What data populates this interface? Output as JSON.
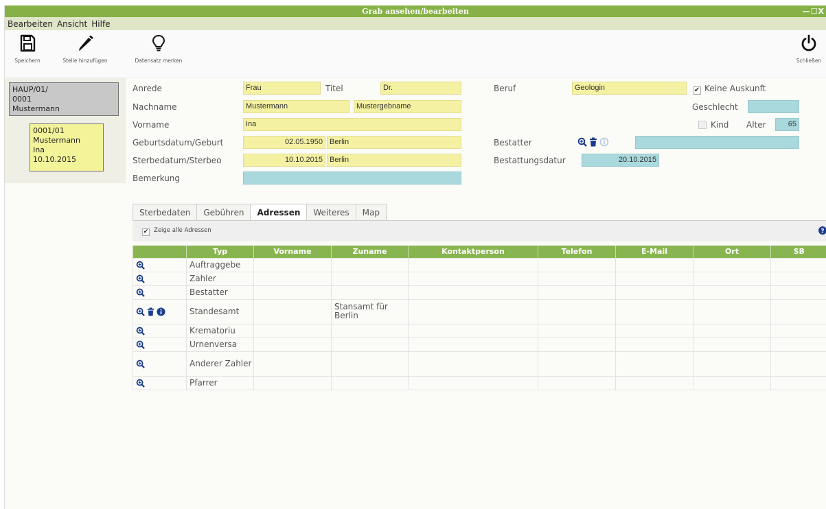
{
  "window": {
    "title": "Grab ansehen/bearbeiten",
    "controls": "—☐X"
  },
  "menu": [
    "Bearbeiten",
    "Ansicht",
    "Hilfe"
  ],
  "toolbar": {
    "save": "Speichern",
    "add_place": "Stelle hinzufügen",
    "mark": "Datensatz merken",
    "close": "Schließen"
  },
  "tree": {
    "parent": [
      "HAUP/01/",
      "0001",
      "Mustermann"
    ],
    "child": [
      "0001/01",
      "Mustermann",
      "Ina",
      "10.10.2015"
    ]
  },
  "form": {
    "anrede_label": "Anrede",
    "anrede": "Frau",
    "titel_label": "Titel",
    "titel": "Dr.",
    "beruf_label": "Beruf",
    "beruf": "Geologin",
    "keine_auskunft": "Keine Auskunft",
    "nachname_label": "Nachname",
    "nachname": "Mustermann",
    "geburtsname": "Mustergebname",
    "geschlecht_label": "Geschlecht",
    "geschlecht": "",
    "vorname_label": "Vorname",
    "vorname": "Ina",
    "kind_label": "Kind",
    "alter_label": "Alter",
    "alter": "65",
    "geburt_label": "Geburtsdatum/Geburt",
    "geburtsdatum": "02.05.1950",
    "geburtsort": "Berlin",
    "bestatter_label": "Bestatter",
    "bestatter": "",
    "sterbe_label": "Sterbedatum/Sterbeo",
    "sterbedatum": "10.10.2015",
    "sterbeort": "Berlin",
    "bestattungsdatum_label": "Bestattungsdatur",
    "bestattungsdatum": "20.10.2015",
    "bemerkung_label": "Bemerkung",
    "bemerkung": ""
  },
  "tabs": [
    "Sterbedaten",
    "Gebühren",
    "Adressen",
    "Weiteres",
    "Map"
  ],
  "active_tab": "Adressen",
  "zeige_alle": "Zeige alle Adressen",
  "table": {
    "columns": [
      "",
      "Typ",
      "Vorname",
      "Zuname",
      "Kontaktperson",
      "Telefon",
      "E-Mail",
      "Ort",
      "SB"
    ],
    "rows": [
      {
        "typ": "Auftraggebe",
        "zuname": "",
        "icons": [
          "search"
        ]
      },
      {
        "typ": "Zahler",
        "zuname": "",
        "icons": [
          "search"
        ]
      },
      {
        "typ": "Bestatter",
        "zuname": "",
        "icons": [
          "search"
        ]
      },
      {
        "typ": "Standesamt",
        "zuname": "Stansamt für Berlin",
        "icons": [
          "search",
          "trash",
          "info"
        ]
      },
      {
        "typ": "Krematoriu",
        "zuname": "",
        "icons": [
          "search"
        ]
      },
      {
        "typ": "Urnenversa",
        "zuname": "",
        "icons": [
          "search"
        ]
      },
      {
        "typ": "Anderer Zahler",
        "zuname": "",
        "icons": [
          "search"
        ]
      },
      {
        "typ": "Pfarrer",
        "zuname": "",
        "icons": [
          "search"
        ]
      }
    ]
  },
  "colors": {
    "green": "#86b146",
    "yellow_field": "#f5f1a2",
    "blue_field": "#a9d8dd",
    "icon_blue": "#1b3d8f"
  }
}
